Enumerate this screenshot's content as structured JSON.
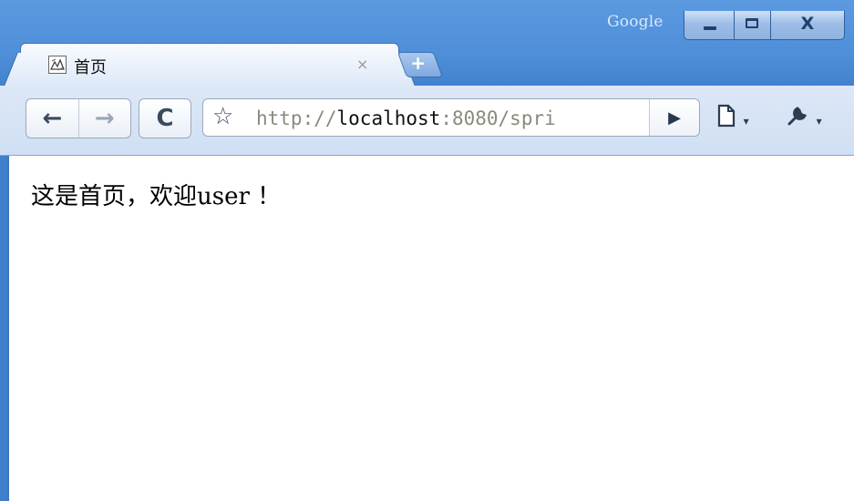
{
  "titlebar": {
    "brand": "Google",
    "close_symbol": "X"
  },
  "tab": {
    "title": "首页",
    "close_symbol": "×",
    "favicon": "page-favicon-icon"
  },
  "new_tab": {
    "symbol": "+"
  },
  "toolbar": {
    "back_symbol": "←",
    "forward_symbol": "→",
    "reload_symbol": "C",
    "star_symbol": "☆",
    "url_scheme": "http://",
    "url_host": "localhost",
    "url_rest": ":8080/spri",
    "go_symbol": "▶",
    "page_menu_symbol": "🗋",
    "tools_menu_symbol": "🔧"
  },
  "page": {
    "message": "这是首页，欢迎user ！"
  },
  "colors": {
    "frame": "#4f8fd9",
    "toolbar": "#dde8f7",
    "content_border": "#3b78c7"
  }
}
